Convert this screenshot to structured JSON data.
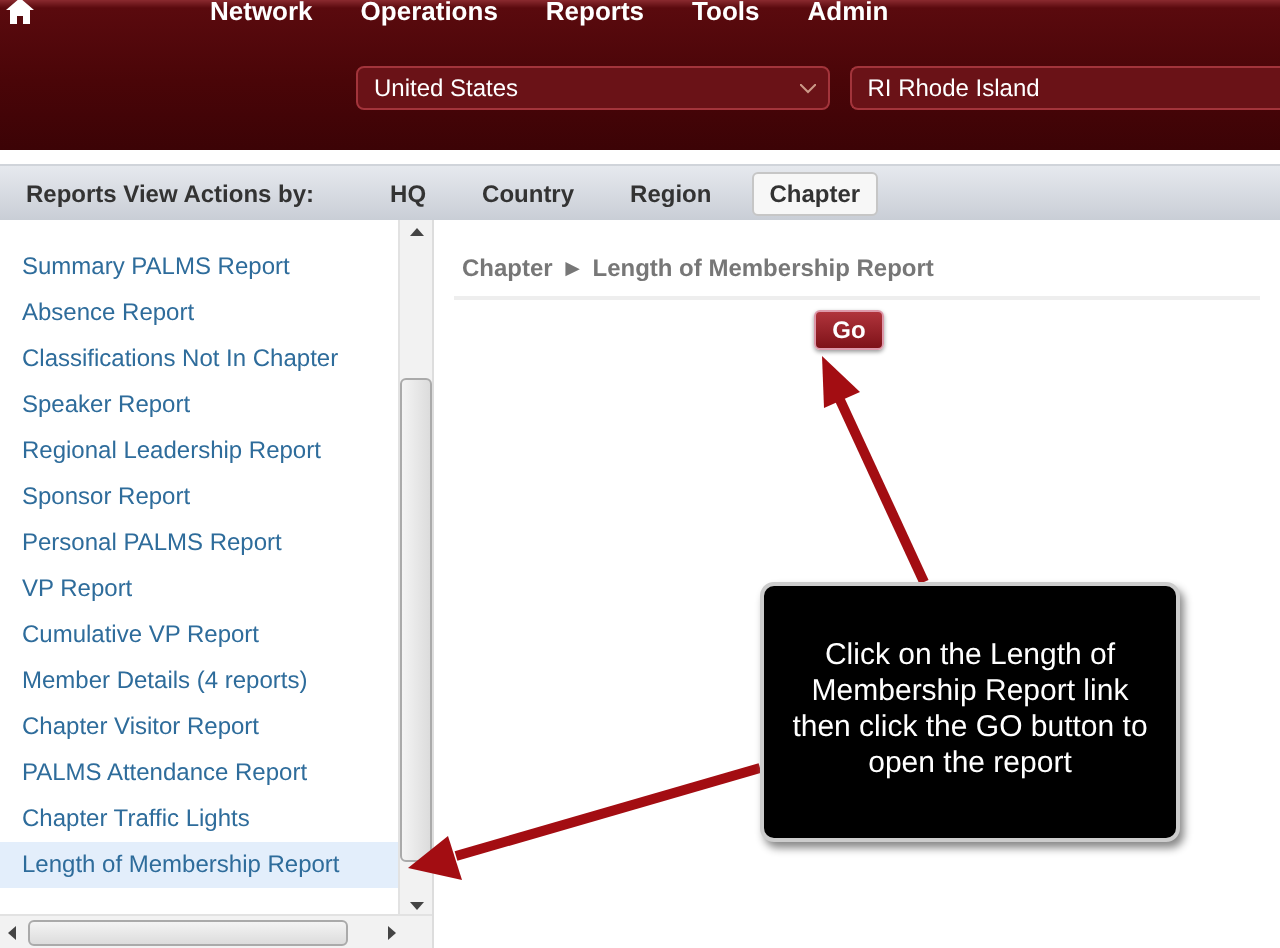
{
  "nav": {
    "items": [
      "Network",
      "Operations",
      "Reports",
      "Tools",
      "Admin"
    ]
  },
  "filters": {
    "country": "United States",
    "region": "RI Rhode Island"
  },
  "action_bar": {
    "label": "Reports View Actions by:",
    "tabs": [
      {
        "label": "HQ",
        "selected": false
      },
      {
        "label": "Country",
        "selected": false
      },
      {
        "label": "Region",
        "selected": false
      },
      {
        "label": "Chapter",
        "selected": true
      }
    ]
  },
  "report_list": [
    {
      "label": "Summary PALMS Report",
      "selected": false
    },
    {
      "label": "Absence Report",
      "selected": false
    },
    {
      "label": "Classifications Not In Chapter",
      "selected": false
    },
    {
      "label": "Speaker Report",
      "selected": false
    },
    {
      "label": "Regional Leadership Report",
      "selected": false
    },
    {
      "label": "Sponsor Report",
      "selected": false
    },
    {
      "label": "Personal PALMS Report",
      "selected": false
    },
    {
      "label": "VP Report",
      "selected": false
    },
    {
      "label": "Cumulative VP Report",
      "selected": false
    },
    {
      "label": "Member Details (4 reports)",
      "selected": false
    },
    {
      "label": "Chapter Visitor Report",
      "selected": false
    },
    {
      "label": "PALMS Attendance Report",
      "selected": false
    },
    {
      "label": "Chapter Traffic Lights",
      "selected": false
    },
    {
      "label": "Length of Membership Report",
      "selected": true
    }
  ],
  "breadcrumb": {
    "parent": "Chapter",
    "separator": "►",
    "current": "Length of Membership Report"
  },
  "go_button": "Go",
  "callout": "Click on the Length of Membership Report link then click the GO button to open the report"
}
